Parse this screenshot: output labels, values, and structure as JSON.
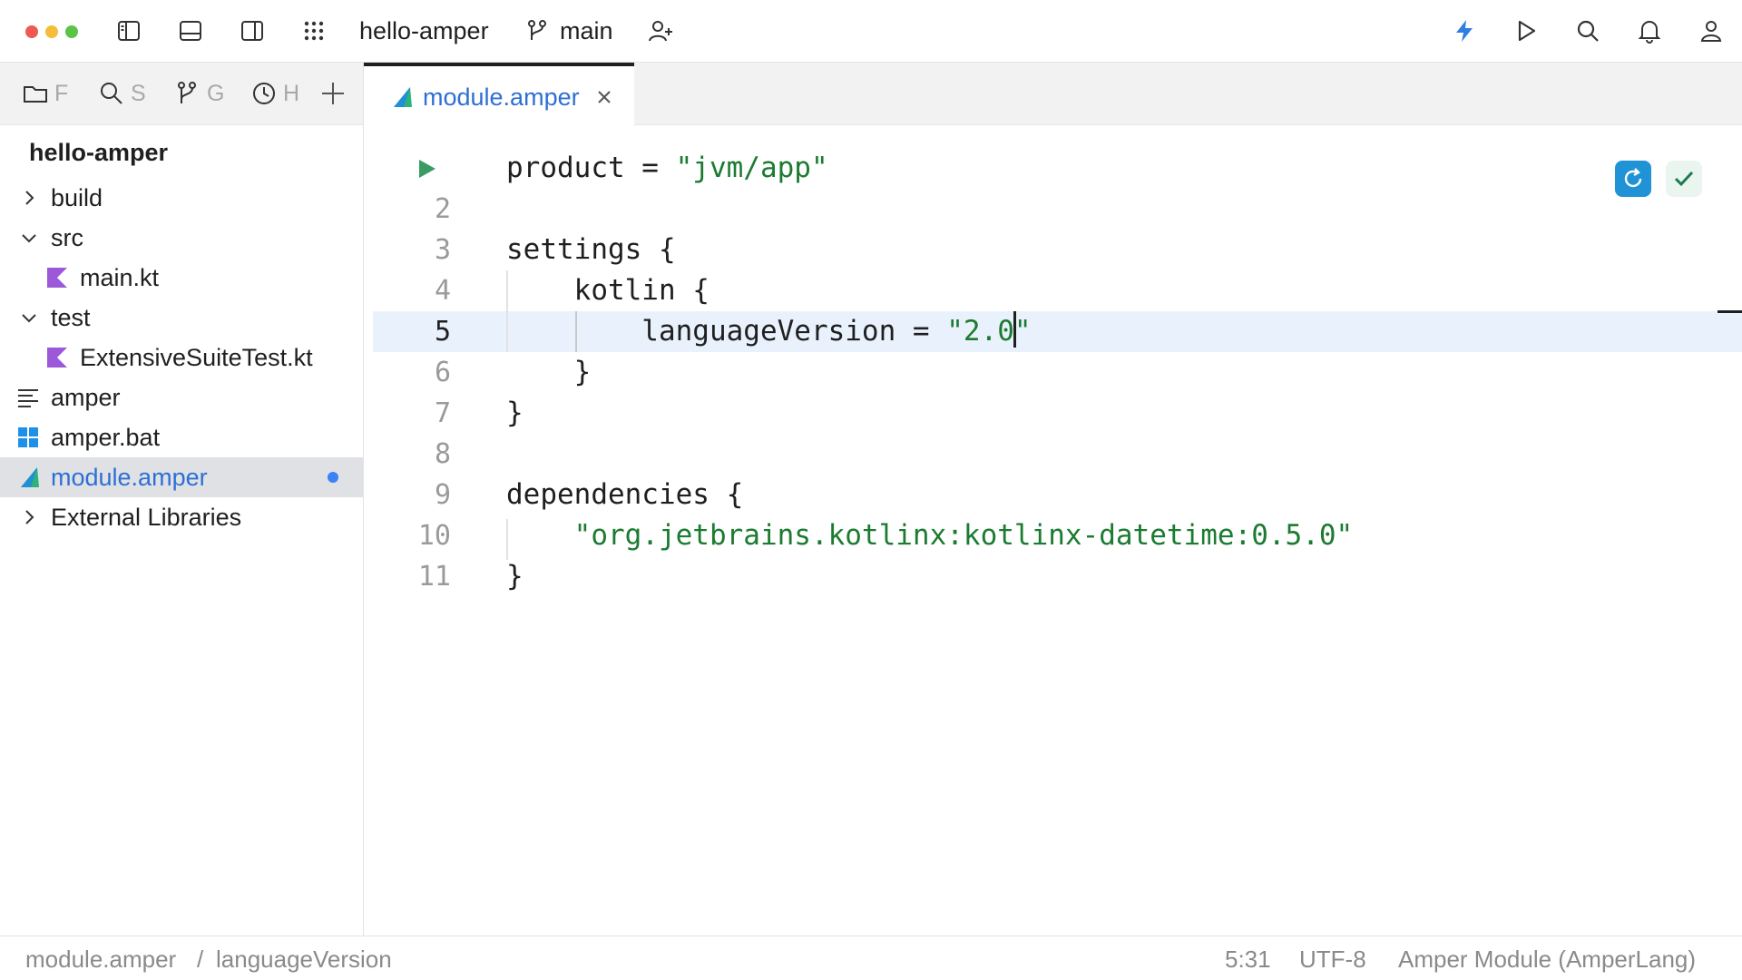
{
  "colors": {
    "accent": "#2f6fd4",
    "string": "#1b7b30",
    "vcs_bar": "#4fa56e",
    "current_line": "#e9f2fc",
    "sync_button": "#1f93d6"
  },
  "titlebar": {
    "window_controls": [
      "close",
      "minimize",
      "maximize"
    ],
    "project_name": "hello-amper",
    "branch": "main",
    "icons": [
      "sidebar-left-icon",
      "bottom-panel-icon",
      "sidebar-right-icon",
      "apps-grid-icon",
      "branch-icon",
      "add-user-icon",
      "bolt-icon",
      "run-icon",
      "search-icon",
      "bell-icon",
      "account-icon"
    ]
  },
  "left_panel": {
    "tabs": [
      {
        "icon": "folder-icon",
        "label": "F"
      },
      {
        "icon": "search-icon",
        "label": "S"
      },
      {
        "icon": "branch-icon",
        "label": "G"
      },
      {
        "icon": "clock-icon",
        "label": "H"
      }
    ],
    "add_icon": "plus-icon",
    "tree": {
      "root": "hello-amper",
      "items": [
        {
          "label": "build",
          "type": "folder",
          "expanded": false
        },
        {
          "label": "src",
          "type": "folder",
          "expanded": true
        },
        {
          "label": "main.kt",
          "type": "kotlin"
        },
        {
          "label": "test",
          "type": "folder",
          "expanded": true
        },
        {
          "label": "ExtensiveSuiteTest.kt",
          "type": "kotlin"
        },
        {
          "label": "amper",
          "type": "text"
        },
        {
          "label": "amper.bat",
          "type": "windows"
        },
        {
          "label": "module.amper",
          "type": "amper",
          "selected": true,
          "modified": true
        },
        {
          "label": "External Libraries",
          "type": "folder",
          "expanded": false
        }
      ]
    }
  },
  "editor": {
    "tab": {
      "label": "module.amper",
      "close_icon": "close-icon"
    },
    "current_line": 5,
    "lines": [
      {
        "num": "",
        "parts": [
          [
            "product = ",
            ""
          ],
          [
            "\"jvm/app\"",
            "str"
          ]
        ]
      },
      {
        "num": "2",
        "parts": []
      },
      {
        "num": "3",
        "parts": [
          [
            "settings {",
            ""
          ]
        ]
      },
      {
        "num": "4",
        "parts": [
          [
            "    kotlin {",
            ""
          ]
        ]
      },
      {
        "num": "5",
        "parts": [
          [
            "        languageVersion = ",
            ""
          ],
          [
            "\"2.0",
            "str"
          ],
          [
            "|",
            "caret"
          ],
          [
            "\"",
            "str"
          ]
        ]
      },
      {
        "num": "6",
        "parts": [
          [
            "    }",
            ""
          ]
        ]
      },
      {
        "num": "7",
        "parts": [
          [
            "}",
            ""
          ]
        ]
      },
      {
        "num": "8",
        "parts": []
      },
      {
        "num": "9",
        "parts": [
          [
            "dependencies {",
            ""
          ]
        ]
      },
      {
        "num": "10",
        "parts": [
          [
            "    ",
            ""
          ],
          [
            "\"org.jetbrains.kotlinx:kotlinx-datetime:0.5.0\"",
            "str"
          ]
        ]
      },
      {
        "num": "11",
        "parts": [
          [
            "}",
            ""
          ]
        ]
      }
    ]
  },
  "statusbar": {
    "breadcrumb": [
      "module.amper",
      "languageVersion"
    ],
    "breadcrumb_separator": "/",
    "position": "5:31",
    "encoding": "UTF-8",
    "file_type": "Amper Module (AmperLang)"
  }
}
